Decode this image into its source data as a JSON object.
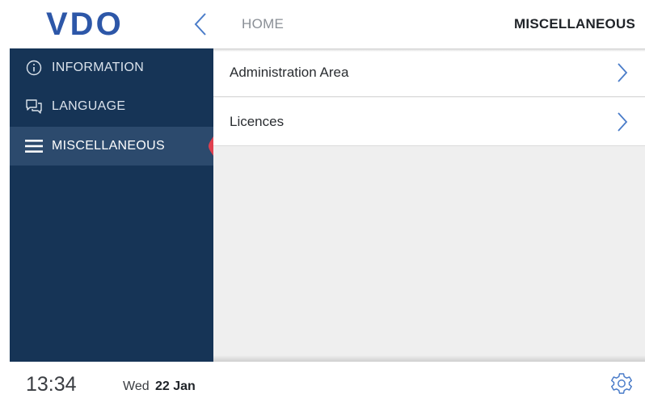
{
  "app": {
    "logo_text": "VDO",
    "brand_color": "#2d57a8"
  },
  "header": {
    "breadcrumb_home": "HOME",
    "page_title": "MISCELLANEOUS",
    "back_icon": "chevron-left-icon"
  },
  "sidebar": {
    "background": "#163456",
    "active_marker_color": "#e0404f",
    "items": [
      {
        "label": "INFORMATION",
        "icon": "info-icon",
        "active": false
      },
      {
        "label": "LANGUAGE",
        "icon": "chat-icon",
        "active": false
      },
      {
        "label": "MISCELLANEOUS",
        "icon": "menu-icon",
        "active": true
      }
    ]
  },
  "main": {
    "items": [
      {
        "label": "Administration Area",
        "icon": "chevron-right-icon"
      },
      {
        "label": "Licences",
        "icon": "chevron-right-icon"
      }
    ]
  },
  "footer": {
    "time": "13:34",
    "day": "Wed",
    "date": "22 Jan",
    "settings_icon": "gear-icon"
  }
}
